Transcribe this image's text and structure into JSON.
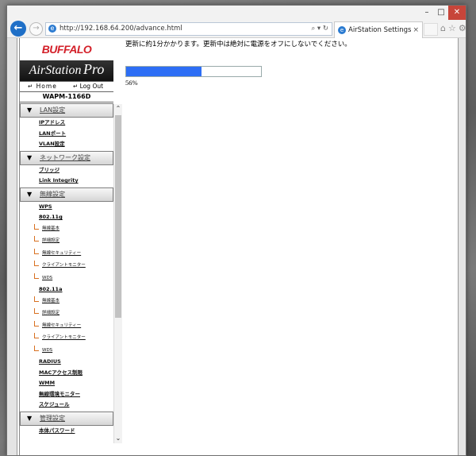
{
  "browser": {
    "url": "http://192.168.64.200/advance.html",
    "tab_title": "AirStation Settings"
  },
  "brand": {
    "logo": "BUFFALO",
    "product_prefix": "AirStation",
    "product_suffix": "Pro",
    "home_label": "Home",
    "logout_label": "Log Out",
    "model": "WAPM-1166D",
    "accent_color": "#d31f28"
  },
  "sidebar": {
    "sections": [
      {
        "label": "LAN設定",
        "items": [
          "IPアドレス",
          "LANポート",
          "VLAN設定"
        ]
      },
      {
        "label": "ネットワーク設定",
        "items": [
          "ブリッジ",
          "Link Integrity"
        ]
      }
    ],
    "wireless": {
      "label": "無線設定",
      "wps": "WPS",
      "band_g": "802.11g",
      "band_g_items": [
        "無線基本",
        "詳細設定",
        "無線セキュリティー",
        "クライアントモニター",
        "WDS"
      ],
      "band_a": "802.11a",
      "band_a_items": [
        "無線基本",
        "詳細設定",
        "無線セキュリティー",
        "クライアントモニター",
        "WDS"
      ],
      "other_items": [
        "RADIUS",
        "MACアクセス制限",
        "WMM",
        "無線環境モニター",
        "スケジュール"
      ]
    },
    "admin": {
      "label": "管理設定",
      "items": [
        "本体パスワード"
      ]
    }
  },
  "main": {
    "message": "更新に約1分かかります。更新中は絶対に電源をオフにしないでください。",
    "progress_value": 56,
    "progress_text": "56%",
    "progress_color": "#2d6ef5"
  }
}
